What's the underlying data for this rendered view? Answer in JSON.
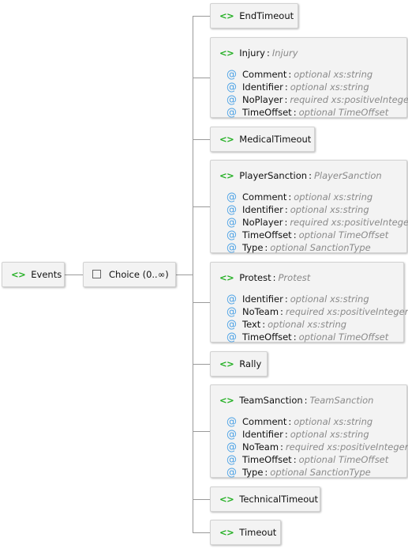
{
  "root": {
    "icon": "element-icon",
    "icon_glyph": "<>",
    "name": "Events"
  },
  "choice": {
    "icon": "choice-icon",
    "icon_glyph": "⋲",
    "label": "Choice (0..∞)"
  },
  "children": [
    {
      "name": "EndTimeout",
      "type": "",
      "attributes": []
    },
    {
      "name": "Injury",
      "type": "Injury",
      "attributes": [
        {
          "name": "Comment",
          "use": "optional",
          "type": "xs:string"
        },
        {
          "name": "Identifier",
          "use": "optional",
          "type": "xs:string"
        },
        {
          "name": "NoPlayer",
          "use": "required",
          "type": "xs:positiveInteger"
        },
        {
          "name": "TimeOffset",
          "use": "optional",
          "type": "TimeOffset"
        }
      ]
    },
    {
      "name": "MedicalTimeout",
      "type": "",
      "attributes": []
    },
    {
      "name": "PlayerSanction",
      "type": "PlayerSanction",
      "attributes": [
        {
          "name": "Comment",
          "use": "optional",
          "type": "xs:string"
        },
        {
          "name": "Identifier",
          "use": "optional",
          "type": "xs:string"
        },
        {
          "name": "NoPlayer",
          "use": "required",
          "type": "xs:positiveInteger"
        },
        {
          "name": "TimeOffset",
          "use": "optional",
          "type": "TimeOffset"
        },
        {
          "name": "Type",
          "use": "optional",
          "type": "SanctionType"
        }
      ]
    },
    {
      "name": "Protest",
      "type": "Protest",
      "attributes": [
        {
          "name": "Identifier",
          "use": "optional",
          "type": "xs:string"
        },
        {
          "name": "NoTeam",
          "use": "required",
          "type": "xs:positiveInteger"
        },
        {
          "name": "Text",
          "use": "optional",
          "type": "xs:string"
        },
        {
          "name": "TimeOffset",
          "use": "optional",
          "type": "TimeOffset"
        }
      ]
    },
    {
      "name": "Rally",
      "type": "",
      "attributes": []
    },
    {
      "name": "TeamSanction",
      "type": "TeamSanction",
      "attributes": [
        {
          "name": "Comment",
          "use": "optional",
          "type": "xs:string"
        },
        {
          "name": "Identifier",
          "use": "optional",
          "type": "xs:string"
        },
        {
          "name": "NoTeam",
          "use": "required",
          "type": "xs:positiveInteger"
        },
        {
          "name": "TimeOffset",
          "use": "optional",
          "type": "TimeOffset"
        },
        {
          "name": "Type",
          "use": "optional",
          "type": "SanctionType"
        }
      ]
    },
    {
      "name": "TechnicalTimeout",
      "type": "",
      "attributes": []
    },
    {
      "name": "Timeout",
      "type": "",
      "attributes": []
    }
  ],
  "glyphs": {
    "element": "<>",
    "attribute": "@",
    "separator": ":"
  }
}
